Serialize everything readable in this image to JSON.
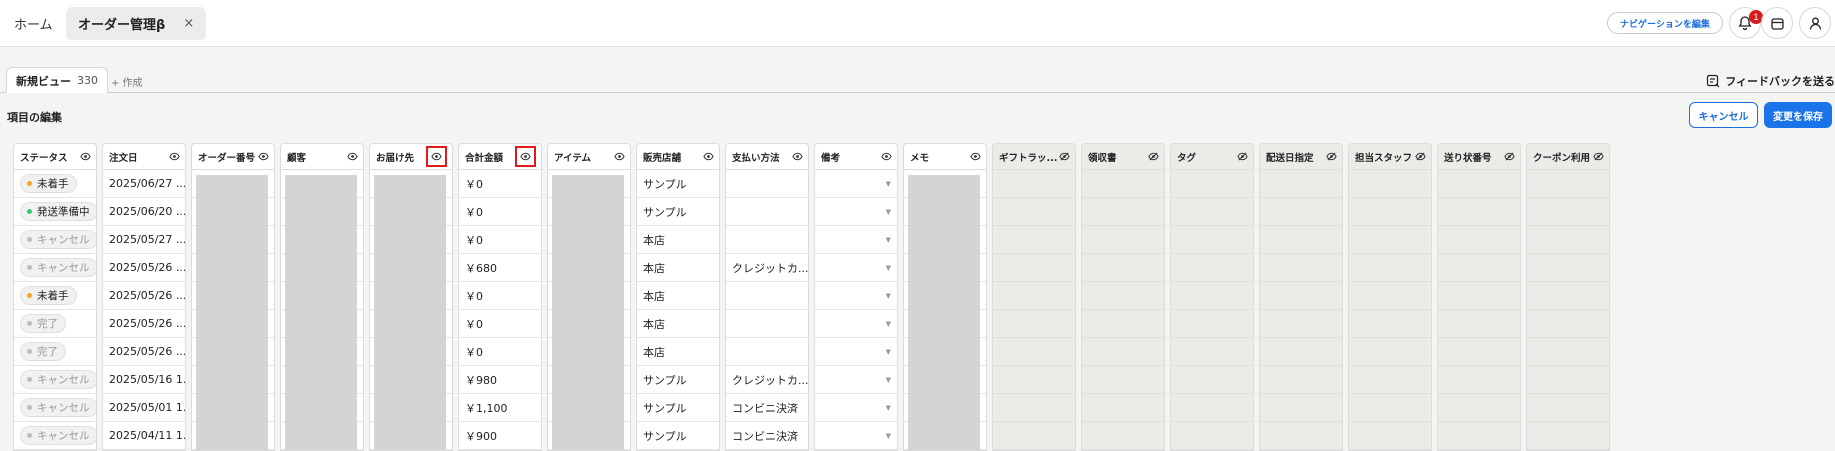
{
  "header": {
    "home_tab": "ホーム",
    "active_tab": "オーダー管理β",
    "close_glyph": "×",
    "nav_edit_label": "ナビゲーションを編集",
    "notification_count": "1",
    "icons": [
      "bell-icon",
      "calendar-icon",
      "user-icon"
    ]
  },
  "views": {
    "active_view": "新規ビュー",
    "active_count": "330",
    "add_label": "+ 作成",
    "feedback_label": "フィードバックを送る"
  },
  "edit": {
    "title": "項目の編集",
    "cancel_label": "キャンセル",
    "save_label": "変更を保存"
  },
  "colors": {
    "accent": "#1a73e8",
    "status_pending": "#f5a623",
    "status_preparing": "#2ecc71",
    "status_muted": "#bdbdbd",
    "highlight_box": "#e01b1b"
  },
  "columns": [
    {
      "label": "ステータス",
      "visible": true
    },
    {
      "label": "注文日",
      "visible": true
    },
    {
      "label": "オーダー番号",
      "visible": true
    },
    {
      "label": "顧客",
      "visible": true
    },
    {
      "label": "お届け先",
      "visible": true,
      "highlighted": true
    },
    {
      "label": "合計金額",
      "visible": true,
      "highlighted": true
    },
    {
      "label": "アイテム",
      "visible": true
    },
    {
      "label": "販売店舗",
      "visible": true
    },
    {
      "label": "支払い方法",
      "visible": true
    },
    {
      "label": "備考",
      "visible": true
    },
    {
      "label": "メモ",
      "visible": true
    },
    {
      "label": "ギフトラッ...",
      "visible": false
    },
    {
      "label": "領収書",
      "visible": false
    },
    {
      "label": "タグ",
      "visible": false
    },
    {
      "label": "配送日指定",
      "visible": false
    },
    {
      "label": "担当スタッフ",
      "visible": false
    },
    {
      "label": "送り状番号",
      "visible": false
    },
    {
      "label": "クーポン利用",
      "visible": false
    }
  ],
  "rows": [
    {
      "status": "未着手",
      "status_kind": "pending",
      "date": "2025/06/27 ...",
      "total": "￥0",
      "store": "サンプル",
      "payment": ""
    },
    {
      "status": "発送準備中",
      "status_kind": "preparing",
      "date": "2025/06/20 ...",
      "total": "￥0",
      "store": "サンプル",
      "payment": ""
    },
    {
      "status": "キャンセル",
      "status_kind": "muted",
      "date": "2025/05/27 ...",
      "total": "￥0",
      "store": "本店",
      "payment": ""
    },
    {
      "status": "キャンセル",
      "status_kind": "muted",
      "date": "2025/05/26 ...",
      "total": "￥680",
      "store": "本店",
      "payment": "クレジットカ..."
    },
    {
      "status": "未着手",
      "status_kind": "pending",
      "date": "2025/05/26 ...",
      "total": "￥0",
      "store": "本店",
      "payment": ""
    },
    {
      "status": "完了",
      "status_kind": "muted",
      "date": "2025/05/26 ...",
      "total": "￥0",
      "store": "本店",
      "payment": ""
    },
    {
      "status": "完了",
      "status_kind": "muted",
      "date": "2025/05/26 ...",
      "total": "￥0",
      "store": "本店",
      "payment": ""
    },
    {
      "status": "キャンセル",
      "status_kind": "muted",
      "date": "2025/05/16 1...",
      "total": "￥980",
      "store": "サンプル",
      "payment": "クレジットカ..."
    },
    {
      "status": "キャンセル",
      "status_kind": "muted",
      "date": "2025/05/01 1...",
      "total": "￥1,100",
      "store": "サンプル",
      "payment": "コンビニ決済"
    },
    {
      "status": "キャンセル",
      "status_kind": "muted",
      "date": "2025/04/11 1...",
      "total": "￥900",
      "store": "サンプル",
      "payment": "コンビニ決済"
    }
  ]
}
